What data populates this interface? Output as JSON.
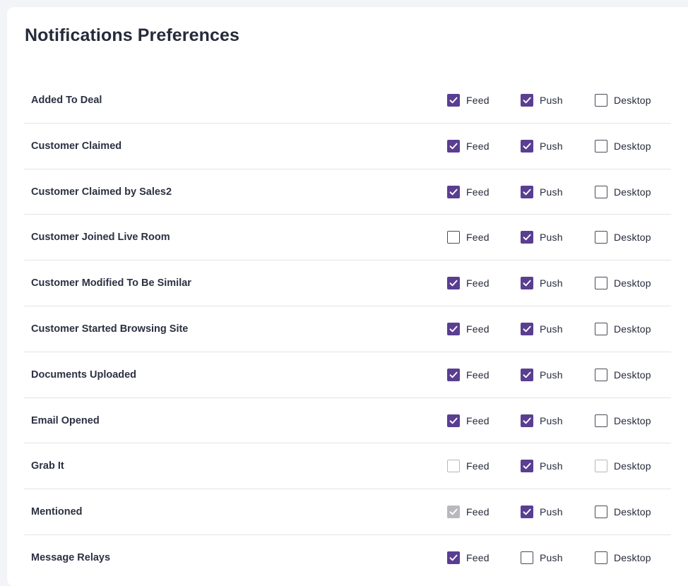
{
  "title": "Notifications Preferences",
  "colors": {
    "accent": "#5a3e91",
    "disabled": "#b9b9bd"
  },
  "option_labels": {
    "feed": "Feed",
    "push": "Push",
    "desktop": "Desktop"
  },
  "rows": [
    {
      "label": "Added To Deal",
      "feed": "checked",
      "push": "checked",
      "desktop": "unchecked"
    },
    {
      "label": "Customer Claimed",
      "feed": "checked",
      "push": "checked",
      "desktop": "unchecked"
    },
    {
      "label": "Customer Claimed by Sales2",
      "feed": "checked",
      "push": "checked",
      "desktop": "unchecked"
    },
    {
      "label": "Customer Joined Live Room",
      "feed": "unchecked",
      "push": "checked",
      "desktop": "unchecked"
    },
    {
      "label": "Customer Modified To Be Similar",
      "feed": "checked",
      "push": "checked",
      "desktop": "unchecked"
    },
    {
      "label": "Customer Started Browsing Site",
      "feed": "checked",
      "push": "checked",
      "desktop": "unchecked"
    },
    {
      "label": "Documents Uploaded",
      "feed": "checked",
      "push": "checked",
      "desktop": "unchecked"
    },
    {
      "label": "Email Opened",
      "feed": "checked",
      "push": "checked",
      "desktop": "unchecked"
    },
    {
      "label": "Grab It",
      "feed": "unchecked-disabled",
      "push": "checked",
      "desktop": "unchecked-disabled"
    },
    {
      "label": "Mentioned",
      "feed": "checked-disabled",
      "push": "checked",
      "desktop": "unchecked"
    },
    {
      "label": "Message Relays",
      "feed": "checked",
      "push": "unchecked",
      "desktop": "unchecked"
    }
  ]
}
